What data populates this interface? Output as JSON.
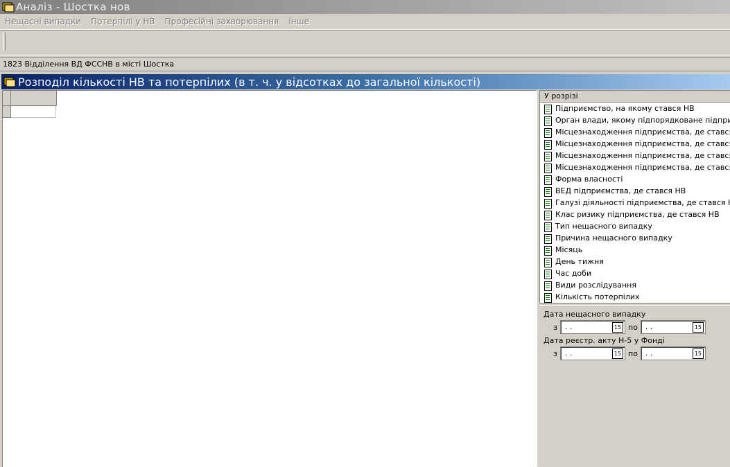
{
  "window": {
    "title": "Аналіз - Шостка нов"
  },
  "menu": [
    "Нещасні випадки",
    "Потерпілі у НВ",
    "Професійні захворювання",
    "Інше"
  ],
  "info_bar": {
    "text": "1823 Відділення ВД ФССНВ в місті Шостка"
  },
  "panel": {
    "title": "Розподіл кількості НВ та потерпілих (в т. ч. у відсотках до загальної кількості)"
  },
  "dimensions": {
    "header": "У розрізі",
    "items": [
      "Підприємство, на якому стався НВ",
      "Орган влади, якому підпорядковане підприємство",
      "Місцезнаходження підприємства, де стався НВ (о",
      "Місцезнаходження підприємства, де стався НВ (с",
      "Місцезнаходження підприємства, де стався НВ (н",
      "Місцезнаходження підприємства, де стався НВ",
      "Форма власності",
      "ВЕД підприємства, де стався НВ",
      "Галузі діяльності підприємства, де стався НВ",
      "Клас ризику підприємства, де стався НВ",
      "Тип нещасного випадку",
      "Причина нещасного випадку",
      "Місяць",
      "День тижня",
      "Час доби",
      "Види розслідування",
      "Кількість потерпілих"
    ]
  },
  "filters": {
    "accident_date": {
      "label": "Дата нещасного випадку",
      "from_label": "з",
      "to_label": "по",
      "from_value": " .  .",
      "to_value": " .  ."
    },
    "registration_date": {
      "label": "Дата реєстр. акту Н-5 у Фонді",
      "from_label": "з",
      "to_label": "по",
      "from_value": " .  .",
      "to_value": " .  ."
    },
    "calendar_icon_text": "15"
  },
  "colors": {
    "panel_header": "#0a246a",
    "doc_icon": "#008000"
  }
}
